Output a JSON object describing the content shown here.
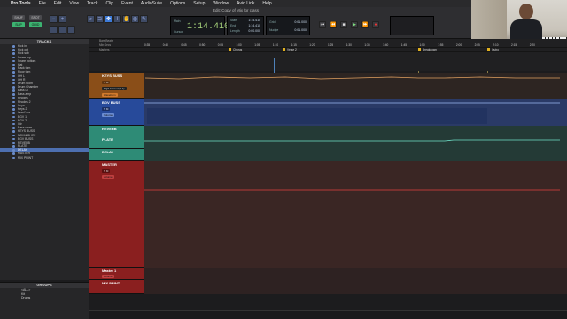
{
  "menubar": {
    "items": [
      "Pro Tools",
      "File",
      "Edit",
      "View",
      "Track",
      "Clip",
      "Event",
      "AudioSuite",
      "Options",
      "Setup",
      "Window",
      "Avid Link",
      "Help"
    ]
  },
  "toolbar": {
    "window_title": "Edit: Copy of Mix for class",
    "mode_shuffle": "SHUF",
    "mode_spot": "SPOT",
    "mode_slip": "SLIP",
    "mode_grid": "GRID",
    "counter_value": "1:14.410",
    "counter_main_label": "Main",
    "counter_sub_label": "Cursor",
    "sel_start_label": "Start",
    "sel_end_label": "End",
    "sel_length_label": "Length",
    "sel_start": "1:14.410",
    "sel_end": "1:14.410",
    "sel_length": "0:00.000",
    "nudge_label": "Nudge",
    "nudge_value": "0:01.000",
    "grid_label": "Grid",
    "grid_value": "0:01.000"
  },
  "tracks_panel": {
    "title": "TRACKS",
    "items": [
      "Kick in",
      "Kick out",
      "Kick sub",
      "Snare top",
      "Snare bottom",
      "Hat",
      "Rack tom",
      "Floor tom",
      "OH L",
      "OH R",
      "Drum room",
      "Drum Chamber",
      "Bass DI",
      "Bass amp",
      "Rhodes",
      "Rhodes 2",
      "Keys",
      "Keys 2",
      "Lead Vox",
      "BGV 1",
      "BGV 2",
      "Gtr",
      "Bass room",
      "KEYS BUSS",
      "DRUM BUSS",
      "BGV BUSS",
      "REVERB",
      "PLATE",
      "DELAY",
      "MASTER",
      "MIX PRINT"
    ],
    "selected_index": 28
  },
  "groups_panel": {
    "title": "GROUPS",
    "items": [
      "<ALL>",
      "Kit",
      "Drums"
    ]
  },
  "ruler": {
    "rows": [
      "Bars|Beats",
      "Min:Secs",
      "Markers"
    ],
    "ticks": [
      "0:35",
      "0:40",
      "0:45",
      "0:50",
      "0:55",
      "1:00",
      "1:05",
      "1:10",
      "1:15",
      "1:20",
      "1:25",
      "1:30",
      "1:35",
      "1:40",
      "1:45",
      "1:50",
      "1:55",
      "2:00",
      "2:05",
      "2:10",
      "2:15",
      "2:20"
    ],
    "markers": [
      "Chorus",
      "Verse 2",
      "Breakdown",
      "Outro"
    ]
  },
  "tracks": {
    "keys_buss": {
      "name": "KEYS BUSS",
      "insert": "EQ3 7-Band (0.1)",
      "view": "Waveform"
    },
    "bgv_buss": {
      "name": "BGV BUSS",
      "view": "Volume"
    },
    "reverb": {
      "name": "REVERB"
    },
    "plate": {
      "name": "PLATE"
    },
    "delay": {
      "name": "DELAY"
    },
    "master": {
      "name": "MASTER",
      "view": "volume"
    },
    "master_out": {
      "name": "Master 1",
      "view": "volume"
    },
    "mix_print": {
      "name": "MIX PRINT"
    }
  },
  "colors": {
    "keys": "#d9822b",
    "bgv": "#3b6fd6",
    "aux": "#3fbf9f",
    "master": "#c03030",
    "selection": "#4d6fb0",
    "counter_text": "#a8d47c"
  }
}
